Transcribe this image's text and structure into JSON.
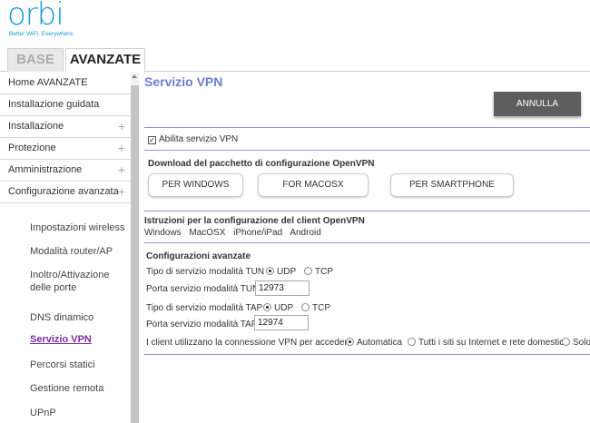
{
  "brand": {
    "name": "orbi",
    "tagline": "Better WiFi. Everywhere."
  },
  "tabs": [
    {
      "label": "BASE"
    },
    {
      "label": "AVANZATE"
    }
  ],
  "sidebar": {
    "items": [
      {
        "label": "Home AVANZATE"
      },
      {
        "label": "Installazione guidata"
      },
      {
        "label": "Installazione"
      },
      {
        "label": "Protezione"
      },
      {
        "label": "Amministrazione"
      },
      {
        "label": "Configurazione avanzata"
      }
    ],
    "subitems": [
      {
        "label": "Impostazioni wireless"
      },
      {
        "label": "Modalità router/AP"
      },
      {
        "label": "Inoltro/Attivazione delle porte"
      },
      {
        "label": "DNS dinamico"
      },
      {
        "label": "Servizio VPN"
      },
      {
        "label": "Percorsi statici"
      },
      {
        "label": "Gestione remota"
      },
      {
        "label": "UPnP"
      }
    ],
    "plus": "+"
  },
  "main": {
    "title": "Servizio VPN",
    "cancel_label": "ANNULLA",
    "enable_vpn_label": "Abilita servizio VPN",
    "download_title": "Download del pacchetto di configurazione OpenVPN",
    "download_buttons": [
      {
        "label": "PER WINDOWS"
      },
      {
        "label": "FOR MACOSX"
      },
      {
        "label": "PER SMARTPHONE"
      }
    ],
    "instructions_title": "Istruzioni per la configurazione del client OpenVPN",
    "instructions_links": [
      "Windows",
      "MacOSX",
      "iPhone/iPad",
      "Android"
    ],
    "advanced_title": "Configurazioni avanzate",
    "tun_type_label": "Tipo di servizio modalità TUN",
    "tun_port_label": "Porta servizio modalità TUN",
    "tun_port_value": "12973",
    "tap_type_label": "Tipo di servizio modalità TAP",
    "tap_port_label": "Porta servizio modalità TAP",
    "tap_port_value": "12974",
    "udp_label": "UDP",
    "tcp_label": "TCP",
    "client_access_label": "I client utilizzano la connessione VPN per accedere",
    "access_options": [
      "Automatica",
      "Tutti i siti su Internet e rete domestica",
      "Solo"
    ]
  },
  "colors": {
    "brand": "#1a9ad6",
    "title": "#6b7fd1",
    "active_link": "#7b2c9c",
    "divider": "#9c8fc7"
  }
}
